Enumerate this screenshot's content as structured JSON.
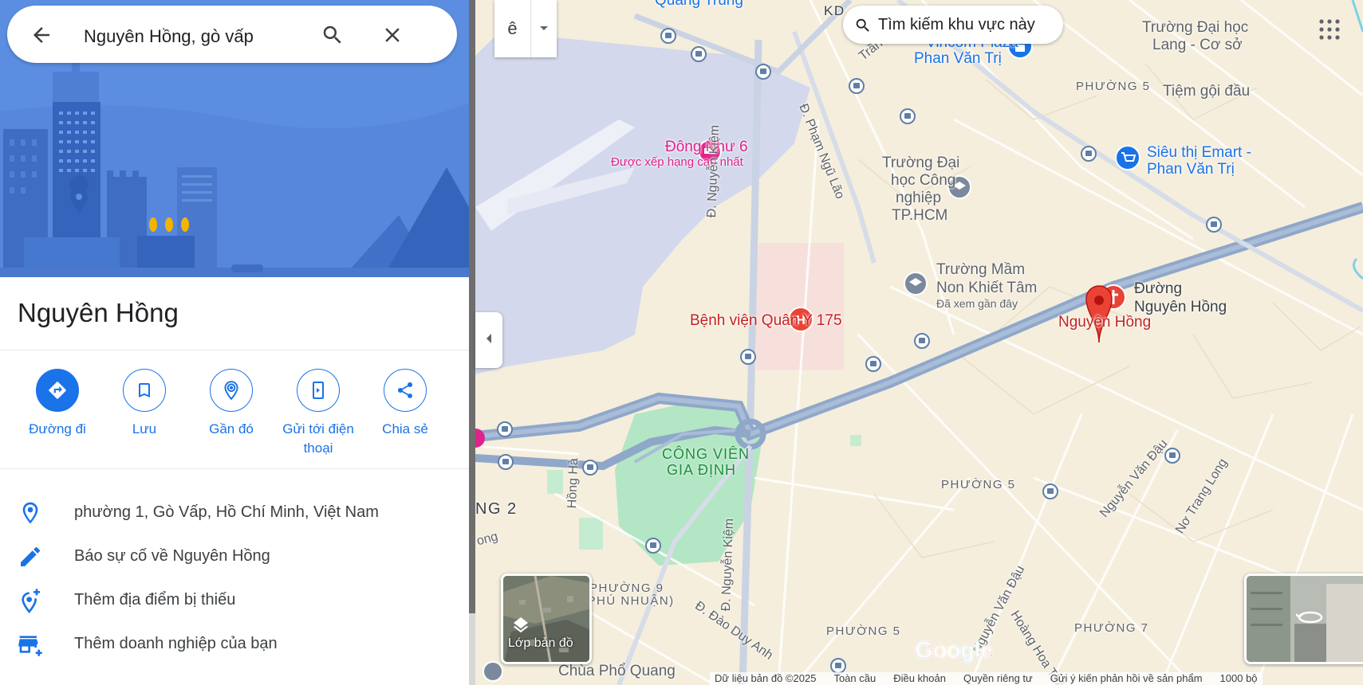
{
  "search": {
    "query": "Nguyên Hồng, gò vấp"
  },
  "place": {
    "title": "Nguyên Hồng"
  },
  "actions": [
    {
      "label": "Đường đi"
    },
    {
      "label": "Lưu"
    },
    {
      "label": "Gần đó"
    },
    {
      "label": "Gửi tới điện thoại"
    },
    {
      "label": "Chia sẻ"
    }
  ],
  "info": {
    "address": "phường 1, Gò Vấp, Hồ Chí Minh, Việt Nam",
    "report": "Báo sự cố về Nguyên Hồng",
    "add_place": "Thêm địa điểm bị thiếu",
    "add_business": "Thêm doanh nghiệp của bạn"
  },
  "map": {
    "search_area_label": "Tìm kiếm khu vực này",
    "input_tool_glyph": "ê",
    "layers_label": "Lớp bản đồ",
    "labels": {
      "dong_nhu": "Đông Như 6",
      "dong_nhu_sub": "Được xếp hạng cao nhất",
      "benh_vien": "Bệnh viện Quân Y 175",
      "nguyen_hong_pin": "Nguyên Hồng",
      "duong_nguyen_hong_1": "Đường",
      "duong_nguyen_hong_2": "Nguyên Hồng",
      "truong_mam_non_1": "Trường Mầm",
      "truong_mam_non_2": "Non Khiết Tâm",
      "truong_mam_non_sub": "Đã xem gần đây",
      "dai_hoc_1": "Trường Đại",
      "dai_hoc_2": "học Công",
      "dai_hoc_3": "nghiệp",
      "dai_hoc_4": "TP.HCM",
      "vincom_1": "Vincom Plaza",
      "vincom_2": "Phan Văn Trị",
      "emart_1": "Siêu thị Emart -",
      "emart_2": "Phan Văn Trị",
      "truong_dai_hoc_lang_1": "Trường Đại học",
      "truong_dai_hoc_lang_2": "Lang - Cơ sở",
      "tiem_goi_dau": "Tiệm gội đầu",
      "cong_vien_1": "CÔNG VIÊN",
      "cong_vien_2": "GIA ĐỊNH",
      "phuong5_a": "PHƯỜNG 5",
      "phuong5_b": "PHƯỜNG 5",
      "phuong5_c": "PHƯỜNG 5",
      "phuong7": "PHƯỜNG 7",
      "phuong9_1": "PHƯỜNG 9",
      "phuong9_2": "(PHÚ NHUẬN)",
      "ng2": "NG 2",
      "kd": "KD",
      "quang_trung": "Quang Trung",
      "chua_pho_quang": "Chùa Phổ Quang",
      "st_nguyen_kiem_1": "Đ. Nguyễn Kiệm",
      "st_nguyen_kiem_2": "Đ. Nguyễn Kiệm",
      "st_pham_ngu_lao": "Đ. Phạm Ngũ Lão",
      "st_tran_thi": "Trần Thị",
      "st_hong_ha": "Hồng Hà",
      "st_dao_duy_anh": "Đ. Đào Duy Anh",
      "st_nguyen_van_dau_1": "Nguyễn Văn Đậu",
      "st_nguyen_van_dau_2": "Nguyễn Văn Đậu",
      "st_hoang_hoa_tham": "Hoàng Hoa Thám",
      "st_no_trang_long": "Nơ Trang Long",
      "st_ong": "ong"
    },
    "google_logo": "Google",
    "footer": {
      "data": "Dữ liệu bản đồ ©2025",
      "global": "Toàn cầu",
      "terms": "Điều khoản",
      "privacy": "Quyền riêng tư",
      "feedback": "Gửi ý kiến phản hồi về sản phẩm",
      "scale": "1000 bộ"
    }
  },
  "colors": {
    "accent": "#1a73e8",
    "hero_bg": "#5b8de1",
    "map_bg": "#f5eedd",
    "water": "#d3d8ec",
    "park": "#b3e6c4",
    "highway": "#8fa7c9",
    "pin": "#ea4335"
  },
  "icons": [
    "back-arrow-icon",
    "search-icon",
    "close-icon",
    "directions-icon",
    "bookmark-icon",
    "nearby-icon",
    "send-to-phone-icon",
    "share-icon",
    "location-pin-icon",
    "pencil-icon",
    "add-location-icon",
    "add-business-icon",
    "layers-icon",
    "apps-grid-icon",
    "chevron-left-icon",
    "dropdown-arrow-icon",
    "bus-stop-icon"
  ]
}
